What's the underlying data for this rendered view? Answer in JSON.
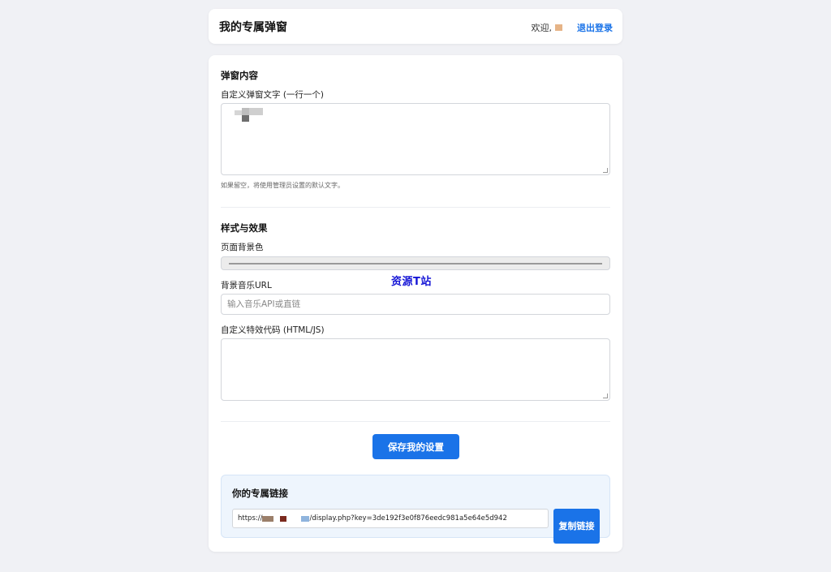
{
  "header": {
    "title": "我的专属弹窗",
    "welcome": "欢迎,",
    "logout": "退出登录"
  },
  "content_section": {
    "title": "弹窗内容",
    "textarea_label": "自定义弹窗文字 (一行一个)",
    "hint": "如果留空，将使用管理员设置的默认文字。"
  },
  "style_section": {
    "title": "样式与效果",
    "bg_color_label": "页面背景色",
    "music_label": "背景音乐URL",
    "music_placeholder": "输入音乐API或直链",
    "effect_label": "自定义特效代码 (HTML/JS)"
  },
  "watermark": "资源T站",
  "save_button": "保存我的设置",
  "link_section": {
    "title": "你的专属链接",
    "url_prefix": "https://",
    "url_suffix": "/display.php?key=3de192f3e0f876eedc981a5e64e5d942",
    "copy_button": "复制链接"
  },
  "colors": {
    "accent": "#1a73e8",
    "page_bg": "#f0f1f5",
    "watermark": "#1515d6"
  }
}
